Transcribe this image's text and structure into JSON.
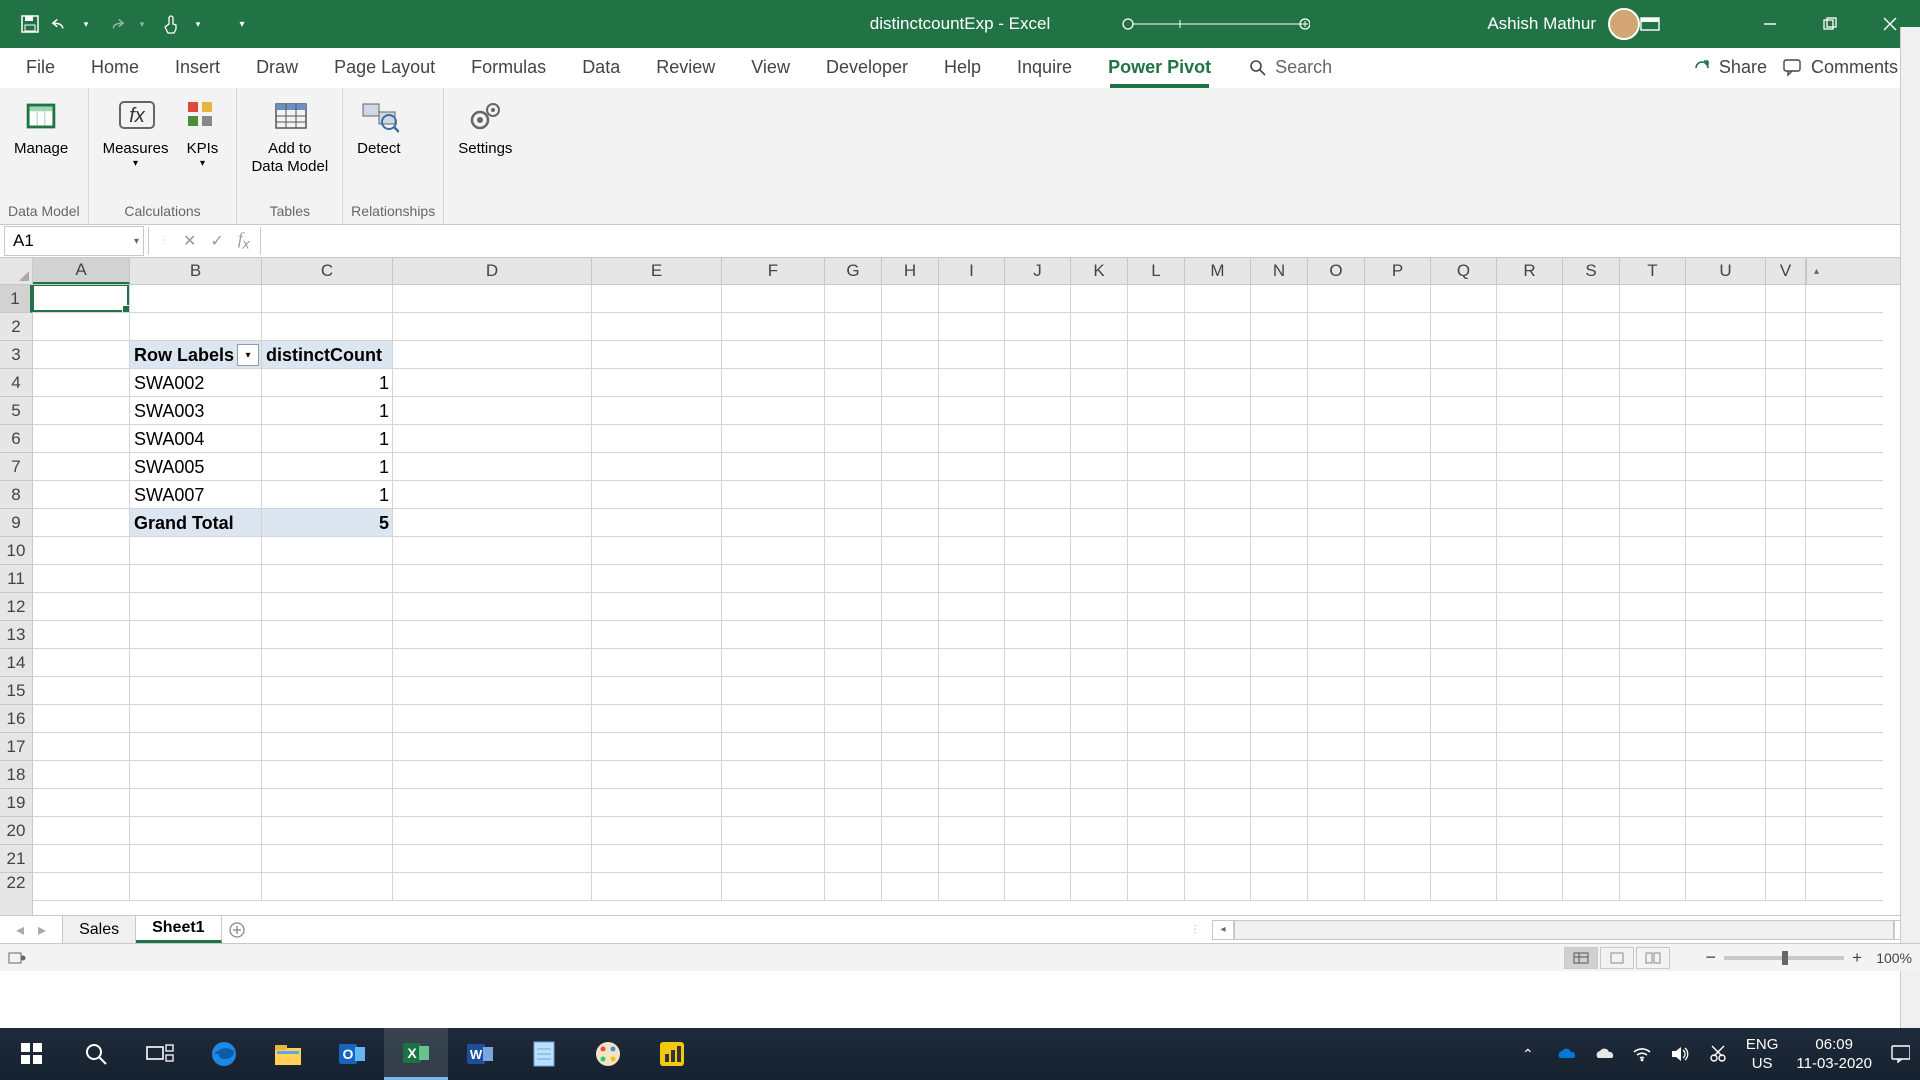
{
  "titlebar": {
    "doc_title": "distinctcountExp  -  Excel",
    "user_name": "Ashish Mathur"
  },
  "ribbon": {
    "tabs": [
      "File",
      "Home",
      "Insert",
      "Draw",
      "Page Layout",
      "Formulas",
      "Data",
      "Review",
      "View",
      "Developer",
      "Help",
      "Inquire",
      "Power Pivot"
    ],
    "active_tab": "Power Pivot",
    "search_placeholder": "Search",
    "share_label": "Share",
    "comments_label": "Comments",
    "groups": {
      "data_model": {
        "label": "Data Model",
        "manage": "Manage"
      },
      "calculations": {
        "label": "Calculations",
        "measures": "Measures",
        "kpis": "KPIs"
      },
      "tables": {
        "label": "Tables",
        "add_line1": "Add to",
        "add_line2": "Data Model"
      },
      "relationships": {
        "label": "Relationships",
        "detect": "Detect"
      },
      "settings": {
        "settings": "Settings"
      }
    }
  },
  "formula_bar": {
    "namebox": "A1",
    "formula": ""
  },
  "columns": [
    "A",
    "B",
    "C",
    "D",
    "E",
    "F",
    "G",
    "H",
    "I",
    "J",
    "K",
    "L",
    "M",
    "N",
    "O",
    "P",
    "Q",
    "R",
    "S",
    "T",
    "U",
    "V"
  ],
  "rows_visible": 22,
  "pivot": {
    "header_rowlabels": "Row Labels",
    "header_value": "distinctCount",
    "rows": [
      {
        "label": "SWA002",
        "value": 1
      },
      {
        "label": "SWA003",
        "value": 1
      },
      {
        "label": "SWA004",
        "value": 1
      },
      {
        "label": "SWA005",
        "value": 1
      },
      {
        "label": "SWA007",
        "value": 1
      }
    ],
    "total_label": "Grand Total",
    "total_value": 5
  },
  "sheets": {
    "tabs": [
      "Sales",
      "Sheet1"
    ],
    "active": "Sheet1"
  },
  "statusbar": {
    "zoom": "100%"
  },
  "taskbar": {
    "lang1": "ENG",
    "lang2": "US",
    "time": "06:09",
    "date": "11-03-2020"
  },
  "chart_data": {
    "type": "table",
    "title": "distinctCount PivotTable",
    "columns": [
      "Row Labels",
      "distinctCount"
    ],
    "rows": [
      [
        "SWA002",
        1
      ],
      [
        "SWA003",
        1
      ],
      [
        "SWA004",
        1
      ],
      [
        "SWA005",
        1
      ],
      [
        "SWA007",
        1
      ],
      [
        "Grand Total",
        5
      ]
    ]
  }
}
